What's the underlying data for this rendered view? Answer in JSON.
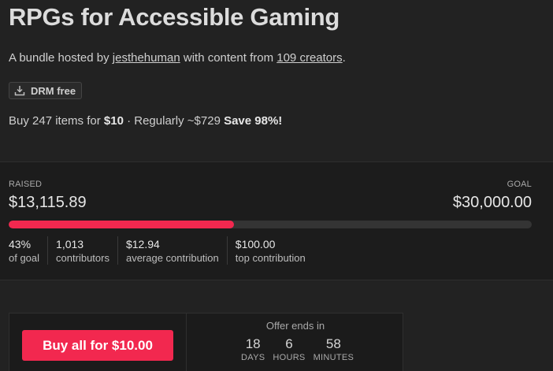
{
  "bundle": {
    "title": "RPGs for Accessible Gaming",
    "byline_prefix": "A bundle hosted by ",
    "host": "jesthehuman",
    "byline_middle": " with content from ",
    "creators_link": "109 creators",
    "byline_suffix": ".",
    "drm_badge": "DRM free"
  },
  "pricing": {
    "prefix": "Buy 247 items for ",
    "price": "$10",
    "middle": " · Regularly ~$729 ",
    "save": "Save 98%!"
  },
  "fundraising": {
    "raised_label": "RAISED",
    "raised_amount": "$13,115.89",
    "goal_label": "GOAL",
    "goal_amount": "$30,000.00",
    "progress_fraction": 0.43,
    "bar_color": "#f2284f",
    "stats": [
      {
        "value": "43%",
        "label": "of goal"
      },
      {
        "value": "1,013",
        "label": "contributors"
      },
      {
        "value": "$12.94",
        "label": "average contribution"
      },
      {
        "value": "$100.00",
        "label": "top contribution"
      }
    ]
  },
  "purchase": {
    "button_label": "Buy all for $10.00",
    "offer_label": "Offer ends in",
    "countdown": [
      {
        "value": "18",
        "unit": "DAYS"
      },
      {
        "value": "6",
        "unit": "HOURS"
      },
      {
        "value": "58",
        "unit": "MINUTES"
      }
    ]
  },
  "icons": {
    "drm": "download-icon"
  }
}
